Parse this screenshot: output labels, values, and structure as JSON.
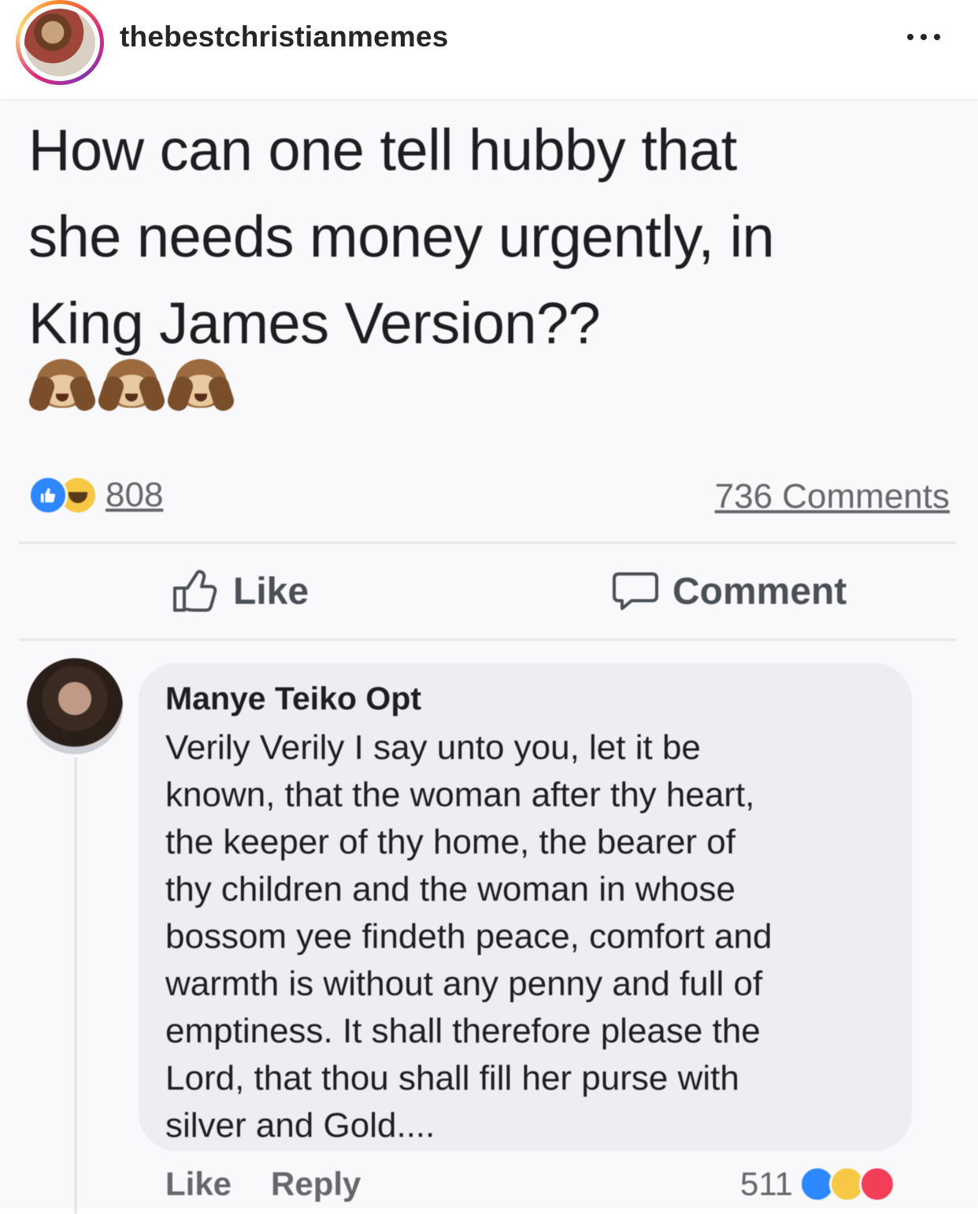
{
  "instagram": {
    "username": "thebestchristianmemes",
    "more_icon": "more-horizontal-icon"
  },
  "post": {
    "text": "How can one tell hubby that\nshe needs money urgently, in\nKing James Version??",
    "emojis": [
      "see-no-evil-monkey",
      "see-no-evil-monkey",
      "see-no-evil-monkey"
    ],
    "reaction_count": "808",
    "comments_count": "736 Comments",
    "actions": {
      "like_label": "Like",
      "comment_label": "Comment"
    }
  },
  "comment": {
    "author": "Manye Teiko Opt",
    "text": "Verily Verily I say unto you, let it be\nknown, that the woman after thy heart,\nthe keeper of thy  home, the bearer of\nthy  children and the woman in whose\nbossom yee findeth peace, comfort and\nwarmth is without any penny  and full of\nemptiness. It shall therefore please the\nLord, that thou shall fill her purse with\nsilver and Gold....",
    "like_label": "Like",
    "reply_label": "Reply",
    "reaction_count": "511"
  },
  "colors": {
    "like_blue": "#2d88ff",
    "haha_yellow": "#f7c843",
    "love_red": "#f33e58",
    "bubble_gray": "#eeedf2"
  }
}
